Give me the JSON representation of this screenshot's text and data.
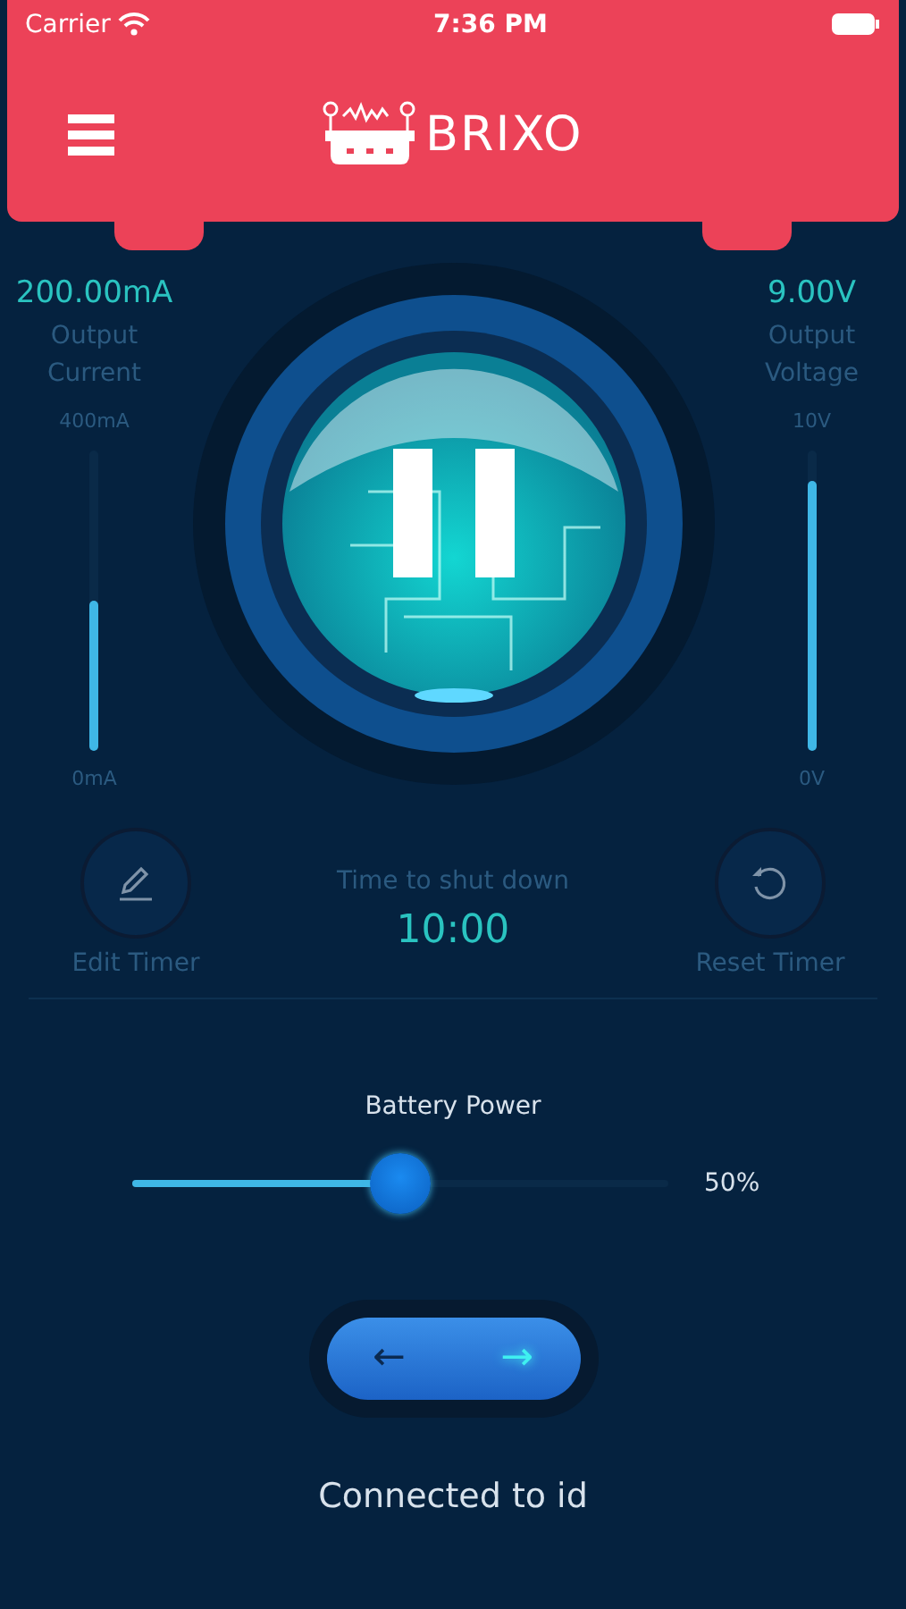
{
  "status_bar": {
    "carrier": "Carrier",
    "time": "7:36 PM"
  },
  "header": {
    "title": "BRIXO"
  },
  "meters": [
    {
      "value": "200.00mA",
      "label": "Output Current",
      "max": "400mA",
      "min": "0mA",
      "level": 0.5
    },
    {
      "value": "9.00V",
      "label": "Output Voltage",
      "max": "10V",
      "min": "0V",
      "level": 0.9
    }
  ],
  "power_button": {
    "on": true
  },
  "timer": {
    "edit_label": "Edit Timer",
    "caption": "Time to shut down",
    "time": "10:00",
    "reset_label": "Reset Timer"
  },
  "battery": {
    "label": "Battery Power",
    "level": 0.5,
    "reading": "50%"
  },
  "direction": [
    {
      "label": "←",
      "selected": false
    },
    {
      "label": "→",
      "selected": true
    }
  ],
  "connection": "Connected to id"
}
